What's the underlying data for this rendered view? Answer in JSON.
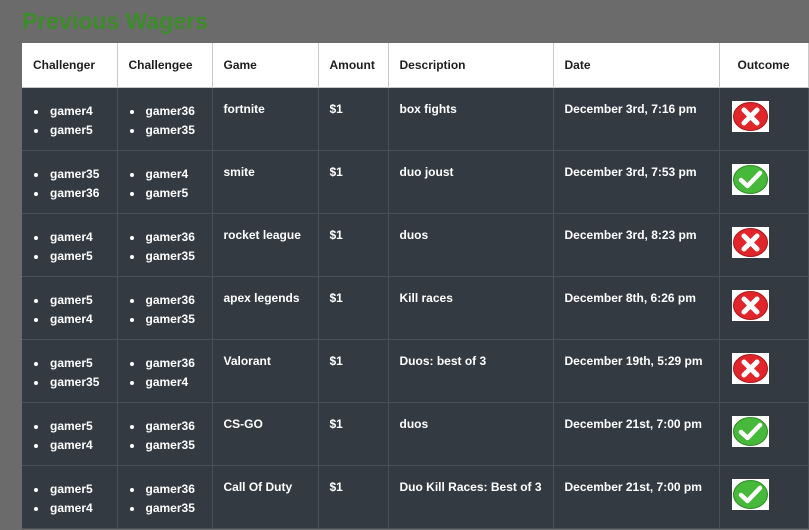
{
  "page": {
    "title": "Previous Wagers"
  },
  "table": {
    "headers": [
      "Challenger",
      "Challengee",
      "Game",
      "Amount",
      "Description",
      "Date",
      "Outcome"
    ],
    "rows": [
      {
        "challenger": [
          "gamer4",
          "gamer5"
        ],
        "challengee": [
          "gamer36",
          "gamer35"
        ],
        "game": "fortnite",
        "amount": "$1",
        "description": "box fights",
        "date": "December 3rd, 7:16 pm",
        "outcome": "loss",
        "outcome_icon": "red-x-icon"
      },
      {
        "challenger": [
          "gamer35",
          "gamer36"
        ],
        "challengee": [
          "gamer4",
          "gamer5"
        ],
        "game": "smite",
        "amount": "$1",
        "description": "duo joust",
        "date": "December 3rd, 7:53 pm",
        "outcome": "win",
        "outcome_icon": "green-check-icon"
      },
      {
        "challenger": [
          "gamer4",
          "gamer5"
        ],
        "challengee": [
          "gamer36",
          "gamer35"
        ],
        "game": "rocket league",
        "amount": "$1",
        "description": "duos",
        "date": "December 3rd, 8:23 pm",
        "outcome": "loss",
        "outcome_icon": "red-x-icon"
      },
      {
        "challenger": [
          "gamer5",
          "gamer4"
        ],
        "challengee": [
          "gamer36",
          "gamer35"
        ],
        "game": "apex legends",
        "amount": "$1",
        "description": "Kill races",
        "date": "December 8th, 6:26 pm",
        "outcome": "loss",
        "outcome_icon": "red-x-icon"
      },
      {
        "challenger": [
          "gamer5",
          "gamer35"
        ],
        "challengee": [
          "gamer36",
          "gamer4"
        ],
        "game": "Valorant",
        "amount": "$1",
        "description": "Duos: best of 3",
        "date": "December 19th, 5:29 pm",
        "outcome": "loss",
        "outcome_icon": "red-x-icon"
      },
      {
        "challenger": [
          "gamer5",
          "gamer4"
        ],
        "challengee": [
          "gamer36",
          "gamer35"
        ],
        "game": "CS-GO",
        "amount": "$1",
        "description": "duos",
        "date": "December 21st, 7:00 pm",
        "outcome": "win",
        "outcome_icon": "green-check-icon"
      },
      {
        "challenger": [
          "gamer5",
          "gamer4"
        ],
        "challengee": [
          "gamer36",
          "gamer35"
        ],
        "game": "Call Of Duty",
        "amount": "$1",
        "description": "Duo Kill Races: Best of 3",
        "date": "December 21st, 7:00 pm",
        "outcome": "win",
        "outcome_icon": "green-check-icon"
      }
    ]
  },
  "colors": {
    "background": "#6b6b6b",
    "title": "#3d8c2a",
    "header_bg": "#ffffff",
    "row_bg": "#343a42",
    "loss": "#e0262b",
    "win": "#46b83a"
  }
}
